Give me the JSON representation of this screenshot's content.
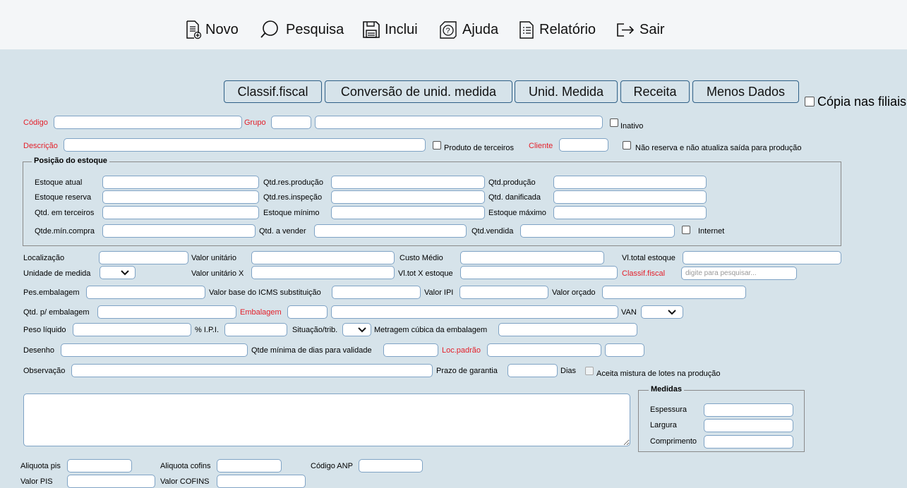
{
  "toolbar": {
    "novo": "Novo",
    "pesquisa": "Pesquisa",
    "inclui": "Inclui",
    "ajuda": "Ajuda",
    "relatorio": "Relatório",
    "sair": "Sair"
  },
  "buttons": {
    "classif_fiscal": "Classif.fiscal",
    "conversao": "Conversão de unid. medida",
    "unid_medida": "Unid. Medida",
    "receita": "Receita",
    "menos_dados": "Menos Dados"
  },
  "copia_filiais": "Cópia nas filiais",
  "labels": {
    "codigo": "Código",
    "grupo": "Grupo",
    "inativo": "Inativo",
    "descricao": "Descrição",
    "produto_terceiros": "Produto de terceiros",
    "cliente": "Cliente",
    "nao_reserva": "Não reserva e não atualiza saída para produção",
    "localizacao": "Localização",
    "valor_unitario": "Valor unitário",
    "custo_medio": "Custo Médio",
    "vl_total_estoque": "Vl.total estoque",
    "unidade_medida": "Unidade de medida",
    "valor_unitario_x": "Valor unitário X",
    "vl_tot_x_estoque": "Vl.tot X estoque",
    "classif_fiscal": "Classif.fiscal",
    "pes_embalagem": "Pes.embalagem",
    "valor_base_icms": "Valor base do ICMS substituição",
    "valor_ipi": "Valor IPI",
    "valor_orcado": "Valor orçado",
    "qtd_p_embalagem": "Qtd. p/ embalagem",
    "embalagem": "Embalagem",
    "van": "VAN",
    "peso_liquido": "Peso líquido",
    "ipi_pct": "% I.P.I.",
    "situacao_trib": "Situação/trib.",
    "metragem_cubica": "Metragem cúbica da embalagem",
    "desenho": "Desenho",
    "qtde_minima_dias": "Qtde mínima de dias para validade",
    "loc_padrao": "Loc.padrão",
    "observacao": "Observação",
    "prazo_garantia": "Prazo de garantia",
    "dias": "Dias",
    "aceita_mistura": "Aceita mistura de lotes na produção",
    "aliquota_pis": "Aliquota pis",
    "aliquota_cofins": "Aliquota cofins",
    "codigo_anp": "Código ANP",
    "valor_pis": "Valor PIS",
    "valor_cofins": "Valor COFINS"
  },
  "estoque": {
    "legend": "Posição do estoque",
    "estoque_atual": "Estoque atual",
    "qtd_res_producao": "Qtd.res.produção",
    "qtd_producao": "Qtd.produção",
    "estoque_reserva": "Estoque reserva",
    "qtd_res_inspecao": "Qtd.res.inspeção",
    "qtd_danificada": "Qtd. danificada",
    "qtd_em_terceiros": "Qtd. em terceiros",
    "estoque_minimo": "Estoque mínimo",
    "estoque_maximo": "Estoque máximo",
    "qtde_min_compra": "Qtde.mín.compra",
    "qtd_a_vender": "Qtd. a vender",
    "qtd_vendida": "Qtd.vendida",
    "internet": "Internet"
  },
  "medidas": {
    "legend": "Medidas",
    "espessura": "Espessura",
    "largura": "Largura",
    "comprimento": "Comprimento"
  },
  "classif_placeholder": "digite para pesquisar..."
}
